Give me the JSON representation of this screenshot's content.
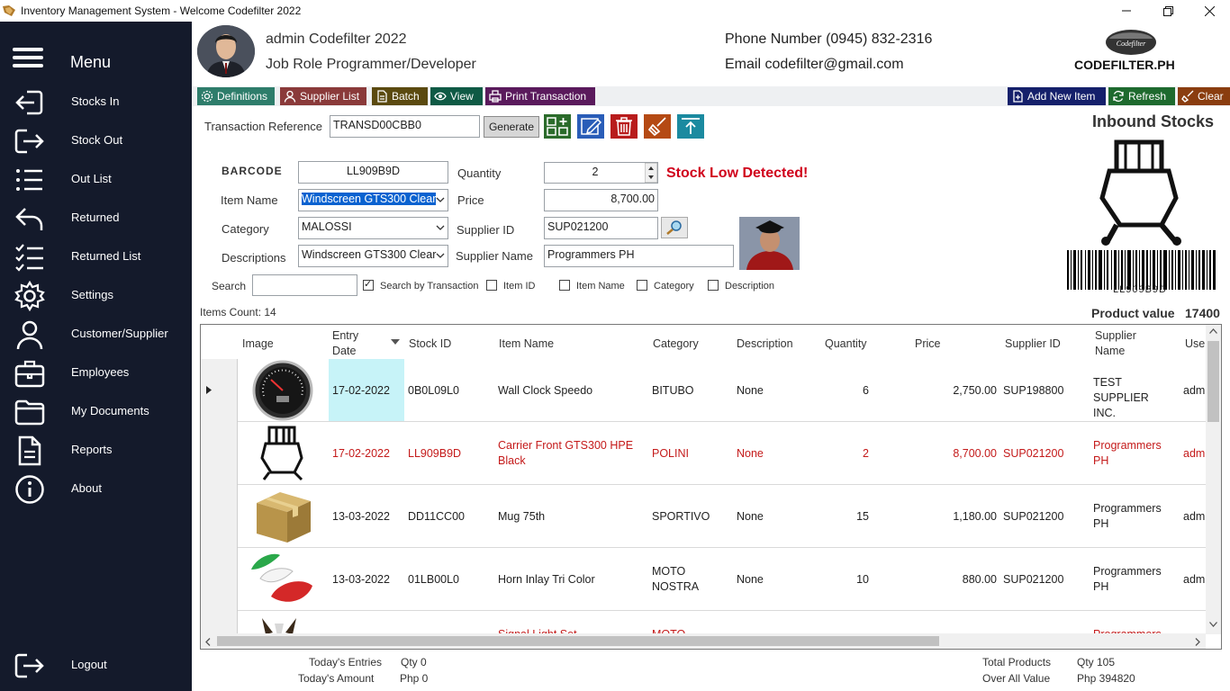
{
  "window": {
    "title": "Inventory Management System - Welcome Codefilter 2022"
  },
  "sidebar": {
    "menu_label": "Menu",
    "items": [
      {
        "label": "Stocks In",
        "icon": "login-arrow-icon"
      },
      {
        "label": "Stock Out",
        "icon": "logout-arrow-icon"
      },
      {
        "label": "Out List",
        "icon": "list-icon"
      },
      {
        "label": "Returned",
        "icon": "return-arrow-icon"
      },
      {
        "label": "Returned List",
        "icon": "checklist-icon"
      },
      {
        "label": "Settings",
        "icon": "gear-icon"
      },
      {
        "label": "Customer/Supplier",
        "icon": "user-icon"
      },
      {
        "label": "Employees",
        "icon": "briefcase-icon"
      },
      {
        "label": "My Documents",
        "icon": "folder-icon"
      },
      {
        "label": "Reports",
        "icon": "document-icon"
      },
      {
        "label": "About",
        "icon": "info-icon"
      }
    ],
    "logout_label": "Logout"
  },
  "header": {
    "user_name": "admin Codefilter 2022",
    "job_role": "Job Role Programmer/Developer",
    "phone": "Phone Number (0945) 832-2316",
    "email": "Email codefilter@gmail.com",
    "logo_text": "CODEFILTER.PH",
    "logo_small": "Codefilter"
  },
  "toolbar": {
    "definitions": "Definitions",
    "supplier_list": "Supplier List",
    "batch": "Batch",
    "view": "View",
    "print_transaction": "Print Transaction",
    "add_new_item": "Add New Item",
    "refresh": "Refresh",
    "clear": "Clear"
  },
  "form": {
    "transaction_reference_label": "Transaction Reference",
    "transaction_reference": "TRANSD00CBB0",
    "generate_label": "Generate",
    "barcode_label": "BARCODE",
    "barcode": "LL909B9D",
    "quantity_label": "Quantity",
    "quantity": "2",
    "stock_warning": "Stock Low Detected!",
    "item_name_label": "Item Name",
    "item_name": "Windscreen GTS300 Clear",
    "price_label": "Price",
    "price": "8,700.00",
    "category_label": "Category",
    "category": "MALOSSI",
    "supplier_id_label": "Supplier ID",
    "supplier_id": "SUP021200",
    "descriptions_label": "Descriptions",
    "descriptions": "Windscreen GTS300 Clear",
    "supplier_name_label": "Supplier Name",
    "supplier_name": "Programmers PH",
    "search_label": "Search",
    "search_value": "",
    "filters": [
      {
        "label": "Search by Transaction",
        "checked": true
      },
      {
        "label": "Item ID",
        "checked": false
      },
      {
        "label": "Item Name",
        "checked": false
      },
      {
        "label": "Category",
        "checked": false
      },
      {
        "label": "Description",
        "checked": false
      }
    ],
    "items_count": "Items Count: 14"
  },
  "preview": {
    "title": "Inbound Stocks",
    "barcode_text": "LL909B9D",
    "product_value_label": "Product value",
    "product_value": "17400"
  },
  "grid": {
    "columns": [
      "Image",
      "Entry Date",
      "Stock ID",
      "Item Name",
      "Category",
      "Description",
      "Quantity",
      "Price",
      "Supplier ID",
      "Supplier Name",
      "Use"
    ],
    "rows": [
      {
        "entry_date": "17-02-2022",
        "stock_id": "0B0L09L0",
        "item_name": "Wall Clock Speedo",
        "category": "BITUBO",
        "description": "None",
        "quantity": "6",
        "price": "2,750.00",
        "supplier_id": "SUP198800",
        "supplier_name": "TEST SUPPLIER INC.",
        "user": "adm",
        "highlight": false,
        "image": "speedometer-image"
      },
      {
        "entry_date": "17-02-2022",
        "stock_id": "LL909B9D",
        "item_name": "Carrier Front GTS300 HPE Black",
        "category": "POLINI",
        "description": "None",
        "quantity": "2",
        "price": "8,700.00",
        "supplier_id": "SUP021200",
        "supplier_name": "Programmers PH",
        "user": "adm",
        "highlight": true,
        "image": "carrier-rack-image"
      },
      {
        "entry_date": "13-03-2022",
        "stock_id": "DD11CC00",
        "item_name": "Mug 75th",
        "category": "SPORTIVO",
        "description": "None",
        "quantity": "15",
        "price": "1,180.00",
        "supplier_id": "SUP021200",
        "supplier_name": "Programmers PH",
        "user": "adm",
        "highlight": false,
        "image": "box-image"
      },
      {
        "entry_date": "13-03-2022",
        "stock_id": "01LB00L0",
        "item_name": "Horn Inlay Tri Color",
        "category": "MOTO NOSTRA",
        "description": "None",
        "quantity": "10",
        "price": "880.00",
        "supplier_id": "SUP021200",
        "supplier_name": "Programmers PH",
        "user": "adm",
        "highlight": false,
        "image": "horn-inlay-image"
      },
      {
        "entry_date": "",
        "stock_id": "",
        "item_name": "Signal Light Set",
        "category": "MOTO",
        "description": "",
        "quantity": "",
        "price": "",
        "supplier_id": "",
        "supplier_name": "Programmers",
        "user": "",
        "highlight": true,
        "image": "signal-light-image"
      }
    ]
  },
  "footer": {
    "todays_entries_label": "Today's Entries",
    "todays_entries": "Qty 0",
    "todays_amount_label": "Today's Amount",
    "todays_amount": "Php 0",
    "total_products_label": "Total Products",
    "total_products": "Qty 105",
    "overall_value_label": "Over All Value",
    "overall_value": "Php 394820"
  },
  "colors": {
    "sidebar_bg": "#141a2b",
    "warning_red": "#d0021b",
    "selected_cell": "#c7f3f8",
    "tb_definitions": "#2e7d6b",
    "tb_supplier": "#8a3a3a",
    "tb_batch": "#5b4a10",
    "tb_view": "#0f5a45",
    "tb_print": "#5a1a5c",
    "tb_add": "#15206b",
    "tb_refresh": "#1e6a2e",
    "tb_clear": "#8a3d0f"
  }
}
